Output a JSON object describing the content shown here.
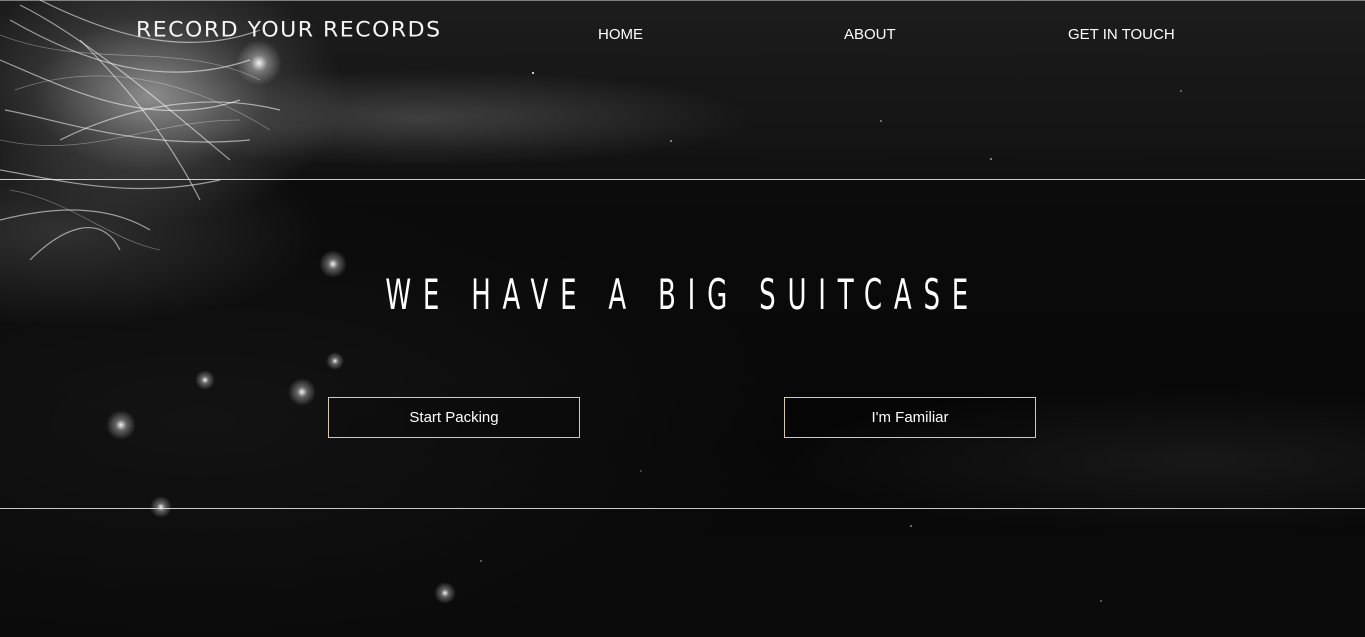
{
  "header": {
    "logo_text": "RECORD YOUR RECORDS",
    "nav": {
      "home": "HOME",
      "about": "ABOUT",
      "contact": "GET IN TOUCH"
    }
  },
  "hero": {
    "headline": "WE HAVE A BIG SUITCASE",
    "buttons": {
      "start": "Start Packing",
      "familiar": "I'm Familiar"
    }
  },
  "theme": {
    "background": "#050505",
    "text": "#ffffff",
    "button_border": "#d8c9a8",
    "divider": "#ebebeb"
  }
}
